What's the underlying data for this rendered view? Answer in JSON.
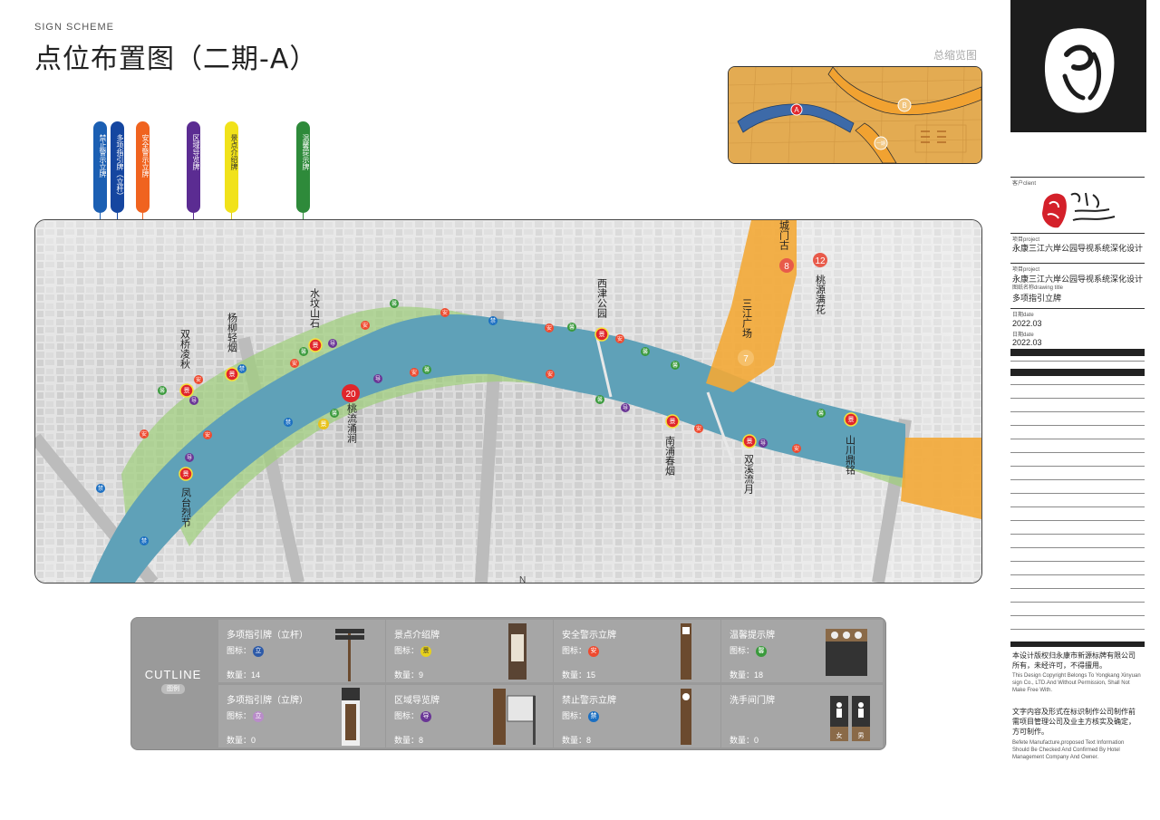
{
  "header": {
    "sign_scheme": "SIGN SCHEME",
    "title": "点位布置图（二期-A）",
    "overview_label": "总缩览图"
  },
  "overview": {
    "marker_a": "A",
    "marker_b": "B",
    "marker_c": "一期"
  },
  "legend_bars": [
    {
      "label": "禁止警示立牌",
      "color": "#1b5fb3"
    },
    {
      "label": "多项指引牌（立杆）",
      "color": "#1546a0"
    },
    {
      "label": "安全警示立牌",
      "color": "#f0631f"
    },
    {
      "label": "区域导览牌",
      "color": "#5b2c92"
    },
    {
      "label": "景点介绍牌",
      "color": "#f1e21a"
    },
    {
      "label": "温馨提示牌",
      "color": "#2e8a3a"
    }
  ],
  "map": {
    "compass": "N",
    "places": [
      {
        "label": "水坟山石"
      },
      {
        "label": "西津公园"
      },
      {
        "label": "杨柳轻烟"
      },
      {
        "label": "双桥凌秋"
      },
      {
        "label": "桃流涌涧"
      },
      {
        "label": "凤台烈节"
      },
      {
        "label": "南浦春烟"
      },
      {
        "label": "双溪流月"
      },
      {
        "label": "山川鼎铭"
      },
      {
        "label": "三江广场"
      },
      {
        "label": "桃源满花"
      },
      {
        "label": "城门古"
      }
    ],
    "numbers": [
      "20",
      "7",
      "8",
      "12"
    ],
    "badge_chars": {
      "an": "安",
      "jin": "禁",
      "dao": "导",
      "jing": "景",
      "xin": "馨"
    },
    "colors": {
      "an": "#ef4a2f",
      "jin": "#1b6fc2",
      "dao": "#6a3696",
      "jing": "#e0262b",
      "xin": "#3a9a3c"
    }
  },
  "cutline": {
    "title": "CUTLINE",
    "subtitle": "图例",
    "icon_label": "图标：",
    "items": [
      {
        "name": "多项指引牌（立杆）",
        "icon": "立",
        "icon_color": "#2d5aa8",
        "count": "数量：14"
      },
      {
        "name": "景点介绍牌",
        "icon": "景",
        "icon_color": "#e7d11b",
        "count": "数量：9"
      },
      {
        "name": "安全警示立牌",
        "icon": "安",
        "icon_color": "#ef4a2f",
        "count": "数量：15"
      },
      {
        "name": "温馨提示牌",
        "icon": "馨",
        "icon_color": "#3a9a3c",
        "count": "数量：18"
      },
      {
        "name": "多项指引牌（立牌）",
        "icon": "立",
        "icon_color": "#b98cc9",
        "count": "数量：0"
      },
      {
        "name": "区域导览牌",
        "icon": "导",
        "icon_color": "#6a3696",
        "count": "数量：8"
      },
      {
        "name": "禁止警示立牌",
        "icon": "禁",
        "icon_color": "#1b6fc2",
        "count": "数量：8"
      },
      {
        "name": "洗手间门牌",
        "icon": "",
        "icon_color": "#999999",
        "count": "数量：0"
      }
    ],
    "restroom_female": "女",
    "restroom_male": "男"
  },
  "right_panel": {
    "client_label": "客户client",
    "project_label_1": "项目project",
    "project_name_1": "永康三江六岸公园导视系统深化设计",
    "project_label_2": "项目project",
    "project_name_2": "永康三江六岸公园导视系统深化设计",
    "drawing_label": "图纸名称drawing title",
    "drawing_title": "多项指引立牌",
    "date_label_1": "日期date",
    "date_1": "2022.03",
    "date_label_2": "日期date",
    "date_2": "2022.03",
    "copyright_cn": "本设计版权归永康市新源标牌有限公司所有，未经许可，不得擅用。",
    "copyright_en": "This Design Copyright Belongs To Yongkang Xinyuan sign Co., LTD.And Without Permission, Shall Not Make Free With.",
    "note_cn": "文字内容及形式在标识制作公司制作前需项目管理公司及业主方核实及确定，方可制作。",
    "note_en": "Befete Manufacture,proposed Text Information Should Be Checked And Confirmed By Hotel Management Company And Owner."
  }
}
